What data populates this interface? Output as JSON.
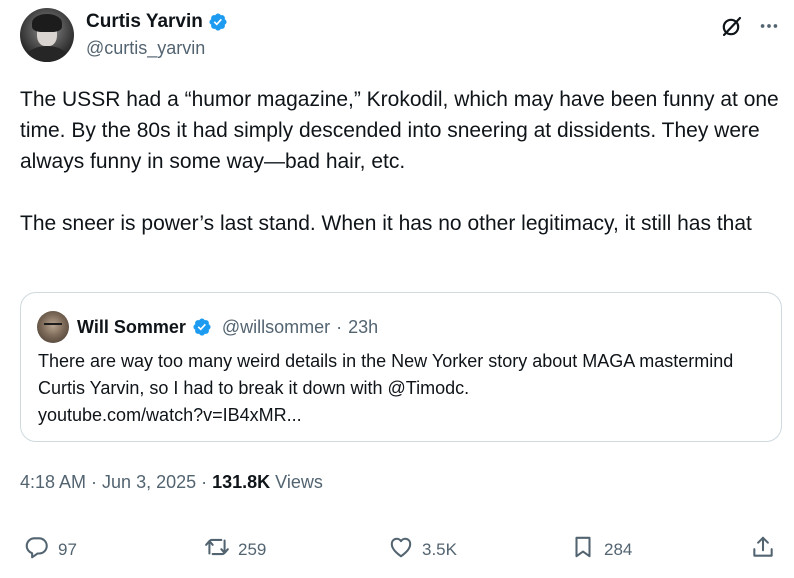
{
  "author": {
    "display_name": "Curtis Yarvin",
    "handle": "@curtis_yarvin"
  },
  "tweet": {
    "text": "The USSR had a “humor magazine,” Krokodil, which may have been funny at one time. By the 80s it had simply descended into sneering at dissidents. They were always funny in some way—bad hair, etc.\n\nThe sneer is power’s last stand. When it has no other legitimacy, it still has that",
    "time": "4:18 AM",
    "date": "Jun 3, 2025",
    "views_count": "131.8K",
    "views_label": "Views",
    "separator": "·"
  },
  "quoted_tweet": {
    "display_name": "Will Sommer",
    "handle": "@willsommer",
    "age": "23h",
    "separator": "·",
    "text": "There are way too many weird details in the New Yorker story about MAGA mastermind Curtis Yarvin, so I had to break it down with @Timodc.\nyoutube.com/watch?v=IB4xMR..."
  },
  "actions": {
    "replies": "97",
    "reposts": "259",
    "likes": "3.5K",
    "bookmarks": "284"
  },
  "colors": {
    "verified": "#1d9bf0",
    "text": "#0f1419",
    "secondary": "#536471",
    "border": "#cfd9de"
  },
  "icons": [
    "verified-badge-icon",
    "grok-icon",
    "more-icon",
    "reply-icon",
    "repost-icon",
    "like-icon",
    "bookmark-icon",
    "share-icon"
  ]
}
